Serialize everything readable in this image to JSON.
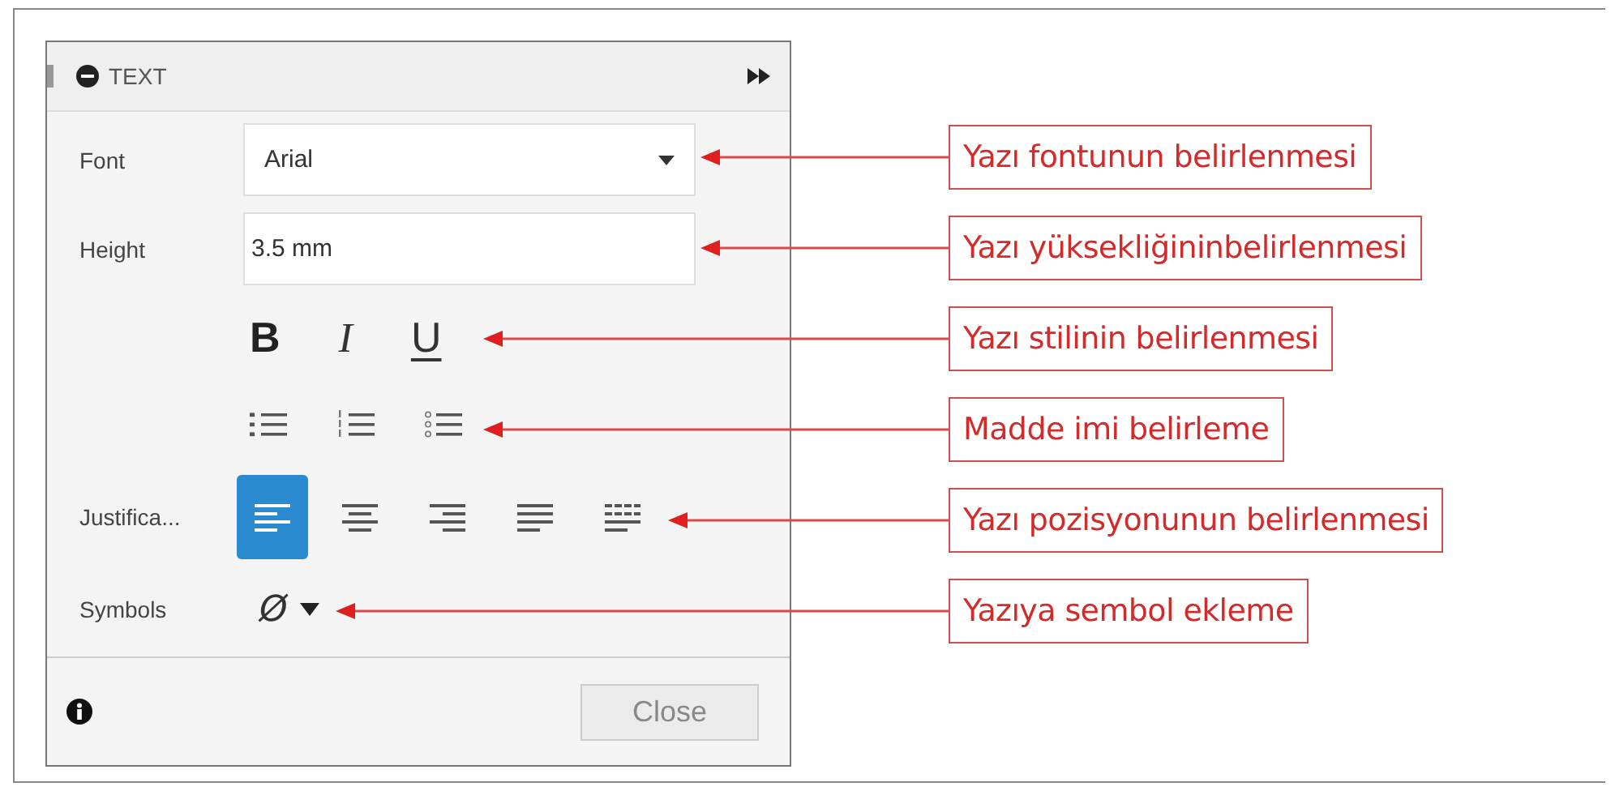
{
  "panel": {
    "title": "TEXT",
    "font": {
      "label": "Font",
      "value": "Arial"
    },
    "height": {
      "label": "Height",
      "value": "3.5 mm"
    },
    "style_buttons": [
      {
        "kind": "bold",
        "label": "B"
      },
      {
        "kind": "italic",
        "label": "I"
      },
      {
        "kind": "underline",
        "label": "U"
      }
    ],
    "list_buttons": [
      {
        "kind": "bullet"
      },
      {
        "kind": "numbered"
      },
      {
        "kind": "lettered"
      }
    ],
    "justification": {
      "label": "Justifica...",
      "options": [
        {
          "kind": "left",
          "selected": true
        },
        {
          "kind": "center",
          "selected": false
        },
        {
          "kind": "right",
          "selected": false
        },
        {
          "kind": "justify",
          "selected": false
        },
        {
          "kind": "distributed",
          "selected": false
        }
      ]
    },
    "symbols": {
      "label": "Symbols",
      "value": "Ø"
    },
    "close_button": "Close"
  },
  "callouts": [
    "Yazı fontunun belirlenmesi",
    "Yazı yüksekliğininbelirlenmesi",
    "Yazı stilinin belirlenmesi",
    "Madde imi belirleme",
    "Yazı pozisyonunun belirlenmesi",
    "Yazıya sembol ekleme"
  ]
}
